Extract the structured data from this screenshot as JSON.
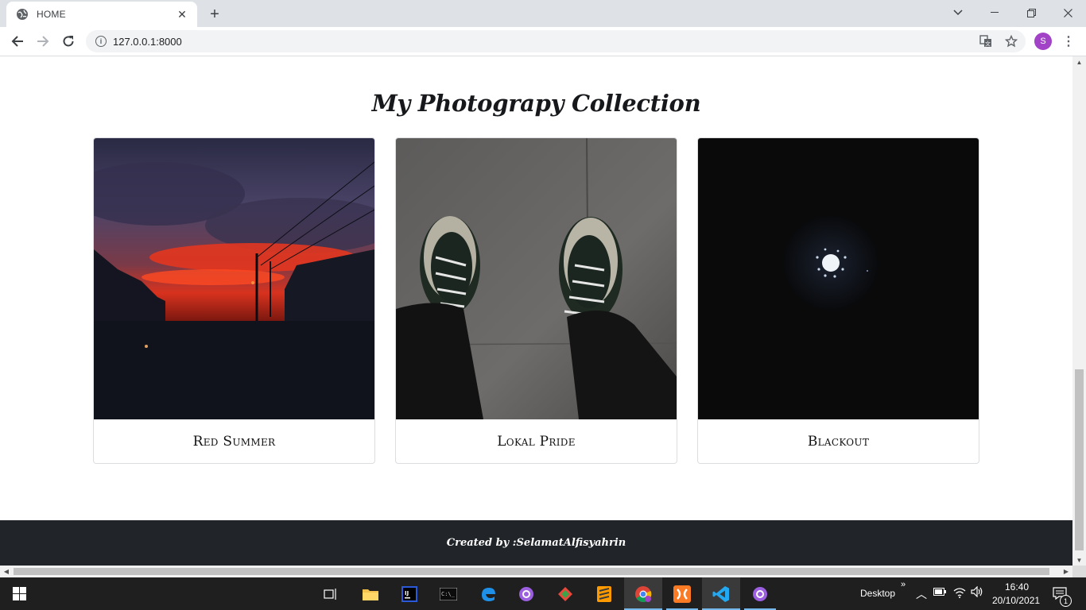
{
  "browser": {
    "tab_title": "HOME",
    "url": "127.0.0.1:8000",
    "profile_initial": "S"
  },
  "page": {
    "heading": "My Photograpy Collection",
    "cards": [
      {
        "caption": "Red Summer"
      },
      {
        "caption": "Lokal Pride"
      },
      {
        "caption": "Blackout"
      }
    ],
    "footer_text": "Created by :SelamatAlfisyahrin"
  },
  "taskbar": {
    "desktop_label": "Desktop",
    "time": "16:40",
    "date": "20/10/2021",
    "notification_count": "1"
  },
  "colors": {
    "footer_bg": "#212529",
    "accent": "#76b9ed",
    "avatar": "#a142c7"
  }
}
